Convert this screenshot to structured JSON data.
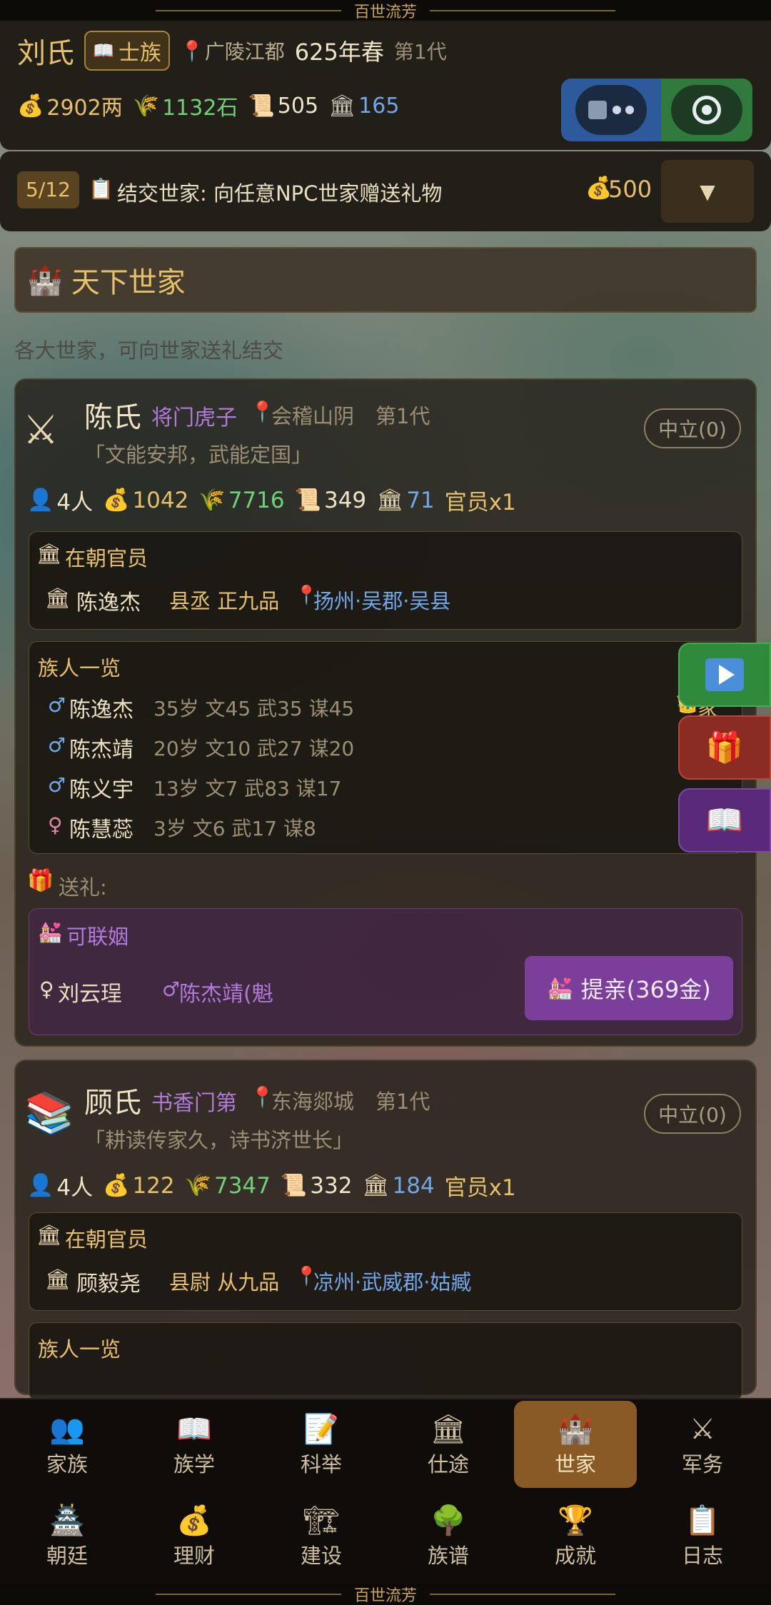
{
  "banner": {
    "title": "百世流芳"
  },
  "header": {
    "family": "刘氏",
    "rank": "士族",
    "location": "广陵江都",
    "date": "625年春",
    "generation": "第1代",
    "stats": {
      "money": "2902两",
      "grain": "1132石",
      "books": "505",
      "prestige": "165"
    }
  },
  "task": {
    "progress": "5/12",
    "text": "结交世家: 向任意NPC世家赠送礼物",
    "reward": "500"
  },
  "section": {
    "title": "天下世家",
    "description": "各大世家，可向世家送礼结交"
  },
  "families": [
    {
      "name": "陈氏",
      "trait": "将门虎子",
      "location": "会稽山阴",
      "generation": "第1代",
      "motto": "「文能安邦，武能定国」",
      "relation": "中立(0)",
      "stats": {
        "people": "4人",
        "money": "1042",
        "grain": "7716",
        "books": "349",
        "prestige": "71",
        "officials": "官员x1"
      },
      "officials_title": "在朝官员",
      "official": {
        "name": "陈逸杰",
        "post": "县丞 正九品",
        "place": "扬州·吴郡·吴县"
      },
      "members_title": "族人一览",
      "members": [
        {
          "gender": "♂",
          "name": "陈逸杰",
          "info": "35岁 文45 武35 谋45",
          "badge": "家主"
        },
        {
          "gender": "♂",
          "name": "陈杰靖",
          "info": "20岁 文10 武27 谋20",
          "badge": ""
        },
        {
          "gender": "♂",
          "name": "陈义宇",
          "info": "13岁 文7 武83 谋17",
          "badge": ""
        },
        {
          "gender": "♀",
          "name": "陈慧蕊",
          "info": "3岁  文6 武17 谋8",
          "badge": ""
        }
      ],
      "gift_label": "送礼:",
      "marriage_title": "可联姻",
      "marriage": {
        "self": "刘云珵",
        "target": "陈杰靖(魁",
        "button": "提亲(369金)"
      }
    },
    {
      "name": "顾氏",
      "trait": "书香门第",
      "location": "东海郯城",
      "generation": "第1代",
      "motto": "「耕读传家久，诗书济世长」",
      "relation": "中立(0)",
      "stats": {
        "people": "4人",
        "money": "122",
        "grain": "7347",
        "books": "332",
        "prestige": "184",
        "officials": "官员x1"
      },
      "officials_title": "在朝官员",
      "official": {
        "name": "顾毅尧",
        "post": "县尉 从九品",
        "place": "凉州·武威郡·姑臧"
      },
      "members_title": "族人一览"
    }
  ],
  "nav": {
    "row1": [
      {
        "label": "家族",
        "icon": "👥"
      },
      {
        "label": "族学",
        "icon": "📖"
      },
      {
        "label": "科举",
        "icon": "📝"
      },
      {
        "label": "仕途",
        "icon": "🏛"
      },
      {
        "label": "世家",
        "icon": "🏰"
      },
      {
        "label": "军务",
        "icon": "⚔"
      }
    ],
    "row2": [
      {
        "label": "朝廷",
        "icon": "🏯"
      },
      {
        "label": "理财",
        "icon": "💰"
      },
      {
        "label": "建设",
        "icon": "🏗"
      },
      {
        "label": "族谱",
        "icon": "🌳"
      },
      {
        "label": "成就",
        "icon": "🏆"
      },
      {
        "label": "日志",
        "icon": "📋"
      }
    ]
  },
  "colors": {
    "accent": "#c8a45a",
    "active_tab": "#8a5a26",
    "green": "#6fd07a",
    "blue": "#6fa7e8",
    "purple": "#b07ad8"
  }
}
